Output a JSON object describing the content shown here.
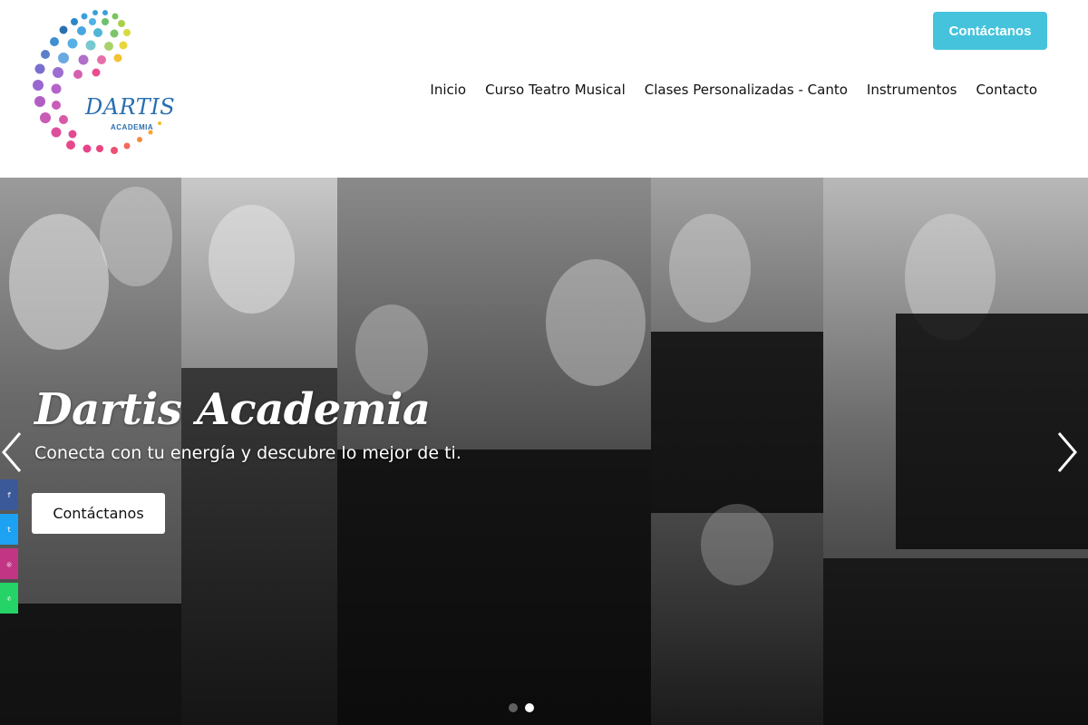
{
  "header": {
    "logo": {
      "name": "DARTIS",
      "tagline": "ACADEMIA"
    },
    "cta_label": "Contáctanos",
    "nav": [
      {
        "label": "Inicio"
      },
      {
        "label": "Curso Teatro Musical"
      },
      {
        "label": "Clases Personalizadas - Canto"
      },
      {
        "label": "Instrumentos"
      },
      {
        "label": "Contacto"
      }
    ]
  },
  "hero": {
    "title": "Dartis Academia",
    "subtitle": "Conecta con tu energía y descubre lo mejor de ti.",
    "cta_label": "Contáctanos",
    "prev_icon": "chevron-left-icon",
    "next_icon": "chevron-right-icon",
    "slides_total": 2,
    "active_slide": 2
  },
  "social": [
    {
      "icon": "facebook-icon",
      "color": "#3b5998"
    },
    {
      "icon": "twitter-icon",
      "color": "#1da1f2"
    },
    {
      "icon": "instagram-icon",
      "color": "#c13584"
    },
    {
      "icon": "whatsapp-icon",
      "color": "#25d366"
    }
  ],
  "colors": {
    "accent": "#45c3dc",
    "logo_blue": "#2a6fb0"
  }
}
